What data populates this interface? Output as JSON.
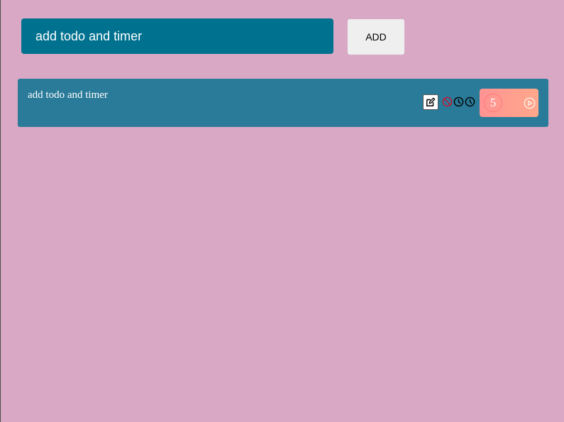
{
  "input": {
    "value": "add todo and timer"
  },
  "add_button": {
    "label": "ADD"
  },
  "todos": [
    {
      "text": "add todo and timer",
      "timer_count": "5",
      "icons": [
        "edit-icon",
        "cancel-icon",
        "clock-icon",
        "clock-icon",
        "play-icon"
      ]
    }
  ],
  "colors": {
    "background": "#d8a8c4",
    "input_bg": "#00718f",
    "todo_bg": "#2a7b99",
    "timer_gradient_start": "#ff9393",
    "timer_gradient_end": "#ffa88b",
    "cancel_icon": "#d0102a"
  }
}
